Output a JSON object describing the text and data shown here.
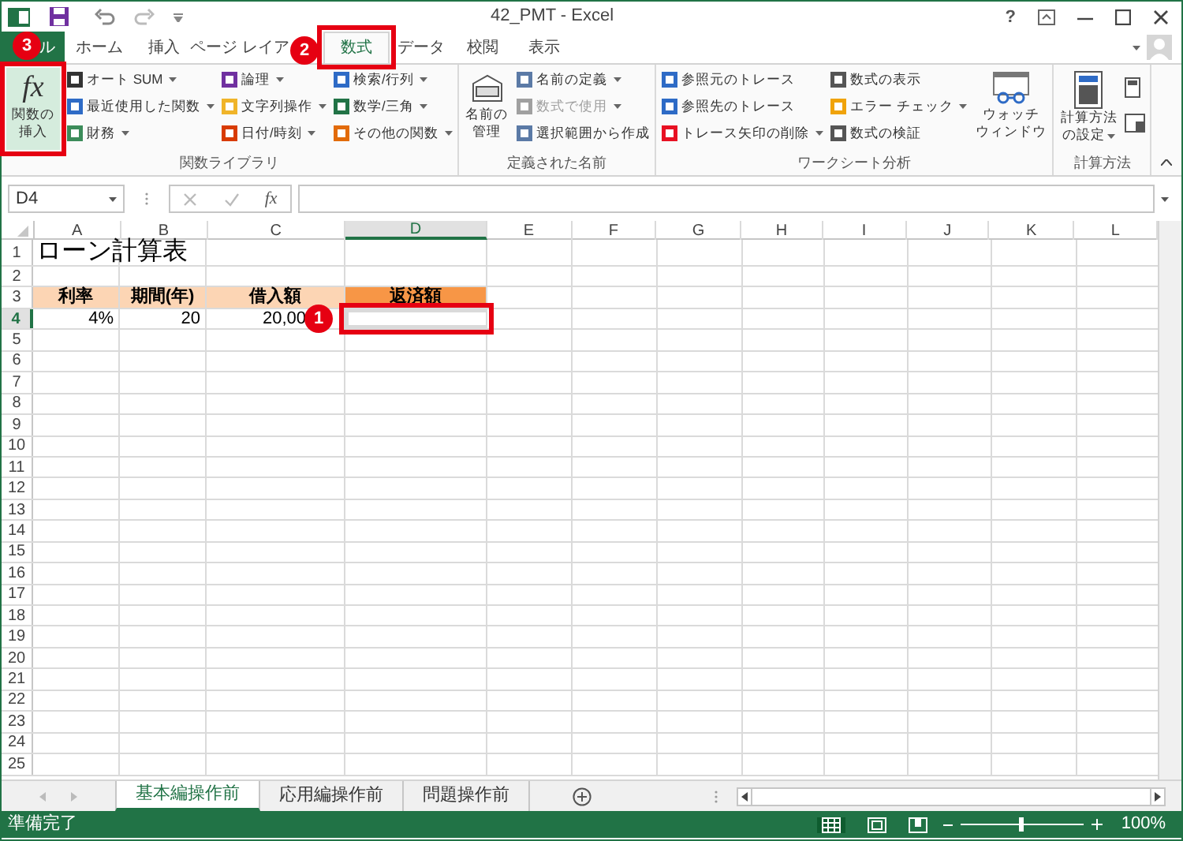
{
  "window": {
    "title": "42_PMT - Excel",
    "help": "?"
  },
  "ribbon_tabs": [
    {
      "label": "ル",
      "kind": "file",
      "selected": false
    },
    {
      "label": "ホーム",
      "kind": "tab",
      "selected": false
    },
    {
      "label": "挿入",
      "kind": "tab",
      "selected": false
    },
    {
      "label": "ページ レイア",
      "kind": "tab",
      "selected": false
    },
    {
      "label": "数式",
      "kind": "tab",
      "selected": true
    },
    {
      "label": "データ",
      "kind": "tab",
      "selected": false
    },
    {
      "label": "校閲",
      "kind": "tab",
      "selected": false
    },
    {
      "label": "表示",
      "kind": "tab",
      "selected": false
    }
  ],
  "ribbon_groups": [
    {
      "label": "関数ライブラリ",
      "columns": [
        {
          "kind": "large",
          "icon_text": "fx",
          "lines": [
            "関数の",
            "挿入"
          ],
          "dropdown": false
        },
        {
          "kind": "stack",
          "items": [
            {
              "label": "オート SUM",
              "dropdown": true,
              "disabled": false,
              "color": "#333333"
            },
            {
              "label": "最近使用した関数",
              "dropdown": true,
              "disabled": false,
              "color": "#2e6bc6"
            },
            {
              "label": "財務",
              "dropdown": true,
              "disabled": false,
              "color": "#3c8c5a"
            }
          ]
        },
        {
          "kind": "stack",
          "items": [
            {
              "label": "論理",
              "dropdown": true,
              "disabled": false,
              "color": "#7030a0"
            },
            {
              "label": "文字列操作",
              "dropdown": true,
              "disabled": false,
              "color": "#f0b429"
            },
            {
              "label": "日付/時刻",
              "dropdown": true,
              "disabled": false,
              "color": "#d83b01"
            }
          ]
        },
        {
          "kind": "stack",
          "items": [
            {
              "label": "検索/行列",
              "dropdown": true,
              "disabled": false,
              "color": "#2e6bc6"
            },
            {
              "label": "数学/三角",
              "dropdown": true,
              "disabled": false,
              "color": "#217346"
            },
            {
              "label": "その他の関数",
              "dropdown": true,
              "disabled": false,
              "color": "#e26b0a"
            }
          ]
        }
      ]
    },
    {
      "label": "定義された名前",
      "columns": [
        {
          "kind": "large",
          "lines": [
            "名前の",
            "管理"
          ],
          "dropdown": false
        },
        {
          "kind": "stack",
          "items": [
            {
              "label": "名前の定義",
              "dropdown": true,
              "disabled": false,
              "color": "#5b7aa6"
            },
            {
              "label": "数式で使用",
              "dropdown": true,
              "disabled": true,
              "color": "#a0a0a0"
            },
            {
              "label": "選択範囲から作成",
              "dropdown": false,
              "disabled": false,
              "color": "#5b7aa6"
            }
          ]
        }
      ]
    },
    {
      "label": "ワークシート分析",
      "columns": [
        {
          "kind": "stack",
          "items": [
            {
              "label": "参照元のトレース",
              "dropdown": false,
              "disabled": false,
              "color": "#2e6bc6"
            },
            {
              "label": "参照先のトレース",
              "dropdown": false,
              "disabled": false,
              "color": "#2e6bc6"
            },
            {
              "label": "トレース矢印の削除",
              "dropdown": true,
              "disabled": false,
              "color": "#e81123"
            }
          ]
        },
        {
          "kind": "stack",
          "items": [
            {
              "label": "数式の表示",
              "dropdown": false,
              "disabled": false,
              "color": "#555555"
            },
            {
              "label": "エラー チェック",
              "dropdown": true,
              "disabled": false,
              "color": "#f0a30a"
            },
            {
              "label": "数式の検証",
              "dropdown": false,
              "disabled": false,
              "color": "#555555"
            }
          ]
        },
        {
          "kind": "large",
          "lines": [
            "ウォッチ",
            "ウィンドウ"
          ],
          "dropdown": false
        }
      ]
    },
    {
      "label": "計算方法",
      "columns": [
        {
          "kind": "large",
          "lines": [
            "計算方法",
            "の設定"
          ],
          "dropdown": true
        },
        {
          "kind": "icons"
        }
      ]
    }
  ],
  "formula_bar": {
    "name_box": "D4",
    "fx": "fx"
  },
  "columns": [
    {
      "label": "A",
      "selected": false
    },
    {
      "label": "B",
      "selected": false
    },
    {
      "label": "C",
      "selected": false
    },
    {
      "label": "D",
      "selected": true
    },
    {
      "label": "E",
      "selected": false
    },
    {
      "label": "F",
      "selected": false
    },
    {
      "label": "G",
      "selected": false
    },
    {
      "label": "H",
      "selected": false
    },
    {
      "label": "I",
      "selected": false
    },
    {
      "label": "J",
      "selected": false
    },
    {
      "label": "K",
      "selected": false
    },
    {
      "label": "L",
      "selected": false
    }
  ],
  "rows": [
    {
      "header": "1",
      "selected": false,
      "cells": [
        {
          "text": "ローン計算表",
          "kind": "title"
        }
      ]
    },
    {
      "header": "2",
      "selected": false,
      "cells": []
    },
    {
      "header": "3",
      "selected": false,
      "cells": [
        {
          "text": "利率",
          "kind": "header",
          "color": "#fcd5b4"
        },
        {
          "text": "期間(年)",
          "kind": "header",
          "color": "#fcd5b4"
        },
        {
          "text": "借入額",
          "kind": "header",
          "color": "#fcd5b4"
        },
        {
          "text": "返済額",
          "kind": "header",
          "color": "#f79646"
        }
      ]
    },
    {
      "header": "4",
      "selected": true,
      "cells": [
        {
          "text": "4%",
          "kind": "value"
        },
        {
          "text": "20",
          "kind": "value"
        },
        {
          "text": "20,00",
          "kind": "value"
        },
        {
          "kind": "active"
        }
      ]
    },
    {
      "header": "5",
      "selected": false,
      "cells": []
    },
    {
      "header": "6",
      "selected": false,
      "cells": []
    },
    {
      "header": "7",
      "selected": false,
      "cells": []
    },
    {
      "header": "8",
      "selected": false,
      "cells": []
    },
    {
      "header": "9",
      "selected": false,
      "cells": []
    },
    {
      "header": "10",
      "selected": false,
      "cells": []
    },
    {
      "header": "11",
      "selected": false,
      "cells": []
    },
    {
      "header": "12",
      "selected": false,
      "cells": []
    },
    {
      "header": "13",
      "selected": false,
      "cells": []
    },
    {
      "header": "14",
      "selected": false,
      "cells": []
    },
    {
      "header": "15",
      "selected": false,
      "cells": []
    },
    {
      "header": "16",
      "selected": false,
      "cells": []
    },
    {
      "header": "17",
      "selected": false,
      "cells": []
    },
    {
      "header": "18",
      "selected": false,
      "cells": []
    },
    {
      "header": "19",
      "selected": false,
      "cells": []
    },
    {
      "header": "20",
      "selected": false,
      "cells": []
    },
    {
      "header": "21",
      "selected": false,
      "cells": []
    },
    {
      "header": "22",
      "selected": false,
      "cells": []
    },
    {
      "header": "23",
      "selected": false,
      "cells": []
    },
    {
      "header": "24",
      "selected": false,
      "cells": []
    },
    {
      "header": "25",
      "selected": false,
      "cells": []
    }
  ],
  "sheet_tabs": [
    {
      "label": "基本編操作前",
      "selected": true
    },
    {
      "label": "応用編操作前",
      "selected": false
    },
    {
      "label": "問題操作前",
      "selected": false
    }
  ],
  "status_bar": {
    "text": "準備完了",
    "zoom": "100%",
    "zoom_level": {
      "level": 0.5
    }
  },
  "callouts": [
    {
      "label": "1"
    },
    {
      "label": "2"
    },
    {
      "label": "3"
    }
  ]
}
